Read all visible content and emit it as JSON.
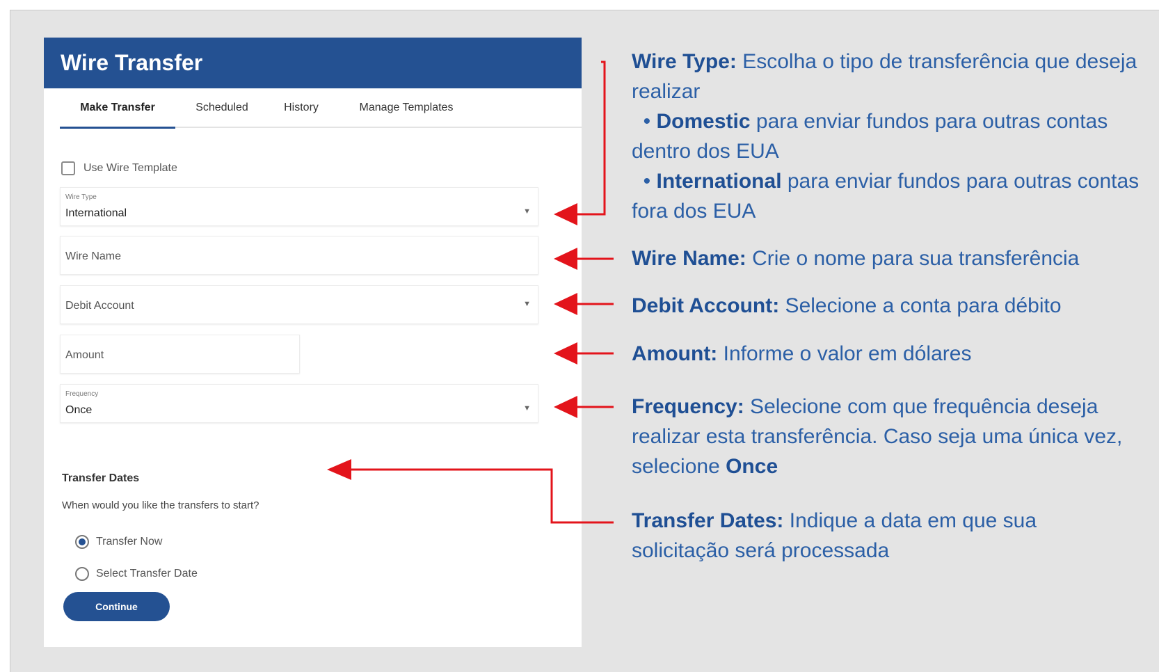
{
  "panel": {
    "title": "Wire Transfer",
    "tabs": [
      {
        "label": "Make Transfer"
      },
      {
        "label": "Scheduled"
      },
      {
        "label": "History"
      },
      {
        "label": "Manage Templates"
      }
    ],
    "active_tab": "Make Transfer",
    "use_template_label": "Use Wire Template",
    "use_template_checked": false,
    "wire_type": {
      "label": "Wire Type",
      "value": "International"
    },
    "wire_name": {
      "placeholder": "Wire Name"
    },
    "debit_account": {
      "placeholder": "Debit Account"
    },
    "amount": {
      "placeholder": "Amount"
    },
    "frequency": {
      "label": "Frequency",
      "value": "Once"
    },
    "transfer_dates_title": "Transfer Dates",
    "transfer_question": "When would you like the transfers to start?",
    "radios": [
      {
        "label": "Transfer Now",
        "selected": true
      },
      {
        "label": "Select Transfer Date",
        "selected": false
      }
    ],
    "continue_label": "Continue"
  },
  "annotations": {
    "wire_type": {
      "title": "Wire Type:",
      "text": " Escolha o tipo de transferência que deseja realizar",
      "bullets": [
        {
          "bold": "Domestic",
          "text": " para enviar fundos para outras contas dentro dos EUA"
        },
        {
          "bold": "International",
          "text": " para enviar fundos para outras contas fora dos EUA"
        }
      ]
    },
    "wire_name": {
      "title": "Wire Name:",
      "text": " Crie o nome para sua transferência"
    },
    "debit_account": {
      "title": "Debit Account:",
      "text": " Selecione a conta para débito"
    },
    "amount": {
      "title": "Amount:",
      "text": " Informe o valor em dólares"
    },
    "frequency": {
      "title": "Frequency:",
      "text": " Selecione com que frequência deseja realizar esta transferência. Caso seja uma única vez, selecione ",
      "bold_end": "Once"
    },
    "transfer_dates": {
      "title": "Transfer Dates:",
      "text": " Indique a data em que sua solicitação será processada"
    }
  },
  "colors": {
    "brand_blue": "#245192",
    "arrow_red": "#e3141b",
    "annotation_blue": "#2b5fa6",
    "background": "#e4e4e4"
  }
}
